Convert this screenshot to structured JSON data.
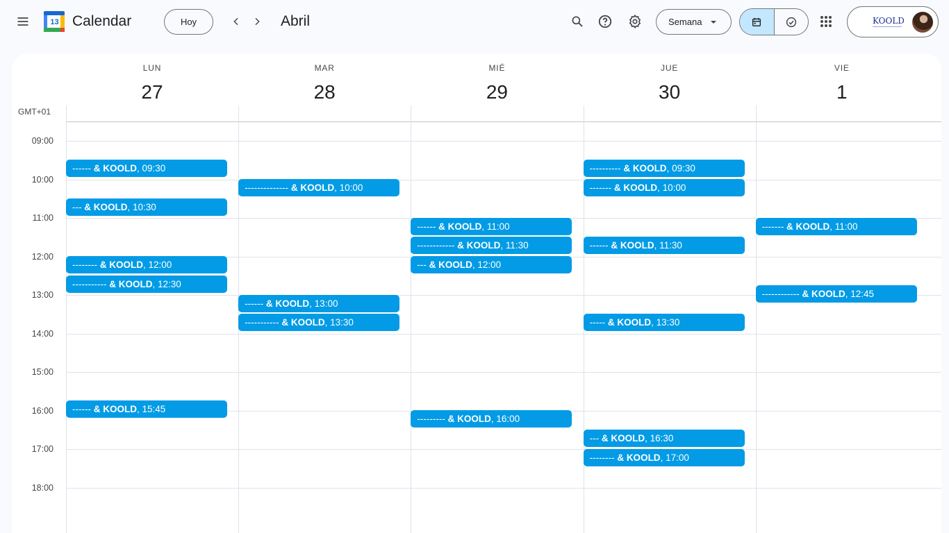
{
  "header": {
    "app_title": "Calendar",
    "logo_day": "13",
    "today_label": "Hoy",
    "month_label": "Abril",
    "view_label": "Semana",
    "brand_label": "KOOLD"
  },
  "calendar": {
    "timezone": "GMT+01",
    "days": [
      {
        "dow": "LUN",
        "num": "27"
      },
      {
        "dow": "MAR",
        "num": "28"
      },
      {
        "dow": "MIÉ",
        "num": "29"
      },
      {
        "dow": "JUE",
        "num": "30"
      },
      {
        "dow": "VIE",
        "num": "1"
      }
    ],
    "hours": [
      "09:00",
      "10:00",
      "11:00",
      "12:00",
      "13:00",
      "14:00",
      "15:00",
      "16:00",
      "17:00",
      "18:00"
    ]
  },
  "events": [
    {
      "day": 0,
      "start": "09:30",
      "prefix": "------",
      "org": "& KOOLD",
      "time": ", 09:30"
    },
    {
      "day": 0,
      "start": "10:30",
      "prefix": "---",
      "org": "& KOOLD",
      "time": ", 10:30"
    },
    {
      "day": 0,
      "start": "12:00",
      "prefix": "--------",
      "org": "& KOOLD",
      "time": ", 12:00"
    },
    {
      "day": 0,
      "start": "12:30",
      "prefix": "-----------",
      "org": "& KOOLD",
      "time": ", 12:30"
    },
    {
      "day": 0,
      "start": "15:45",
      "prefix": "------",
      "org": "& KOOLD",
      "time": ", 15:45"
    },
    {
      "day": 1,
      "start": "10:00",
      "prefix": "--------------",
      "org": "& KOOLD",
      "time": ", 10:00"
    },
    {
      "day": 1,
      "start": "13:00",
      "prefix": "------",
      "org": "& KOOLD",
      "time": ", 13:00"
    },
    {
      "day": 1,
      "start": "13:30",
      "prefix": "-----------",
      "org": "& KOOLD",
      "time": ", 13:30"
    },
    {
      "day": 2,
      "start": "11:00",
      "prefix": "------",
      "org": "& KOOLD",
      "time": ", 11:00"
    },
    {
      "day": 2,
      "start": "11:30",
      "prefix": "------------",
      "org": "& KOOLD",
      "time": ", 11:30"
    },
    {
      "day": 2,
      "start": "12:00",
      "prefix": "---",
      "org": "& KOOLD",
      "time": ", 12:00"
    },
    {
      "day": 2,
      "start": "16:00",
      "prefix": "---------",
      "org": "& KOOLD",
      "time": ", 16:00"
    },
    {
      "day": 3,
      "start": "09:30",
      "prefix": "----------",
      "org": "& KOOLD",
      "time": ", 09:30"
    },
    {
      "day": 3,
      "start": "10:00",
      "prefix": "-------",
      "org": "& KOOLD",
      "time": ", 10:00"
    },
    {
      "day": 3,
      "start": "11:30",
      "prefix": "------",
      "org": "& KOOLD",
      "time": ", 11:30"
    },
    {
      "day": 3,
      "start": "13:30",
      "prefix": "-----",
      "org": "& KOOLD",
      "time": ", 13:30"
    },
    {
      "day": 3,
      "start": "16:30",
      "prefix": "---",
      "org": "& KOOLD",
      "time": ", 16:30"
    },
    {
      "day": 3,
      "start": "17:00",
      "prefix": "--------",
      "org": "& KOOLD",
      "time": ", 17:00"
    },
    {
      "day": 4,
      "start": "11:00",
      "prefix": "-------",
      "org": "& KOOLD",
      "time": ", 11:00"
    },
    {
      "day": 4,
      "start": "12:45",
      "prefix": "------------",
      "org": "& KOOLD",
      "time": ", 12:45"
    }
  ],
  "colors": {
    "event": "#039be5",
    "active_segment": "#c2e7ff",
    "grid_line": "#dde3ea"
  },
  "icons": [
    "menu-icon",
    "search-icon",
    "help-icon",
    "settings-icon",
    "dropdown-arrow-icon",
    "calendar-icon",
    "tasks-check-icon",
    "apps-grid-icon",
    "chevron-left-icon",
    "chevron-right-icon"
  ]
}
